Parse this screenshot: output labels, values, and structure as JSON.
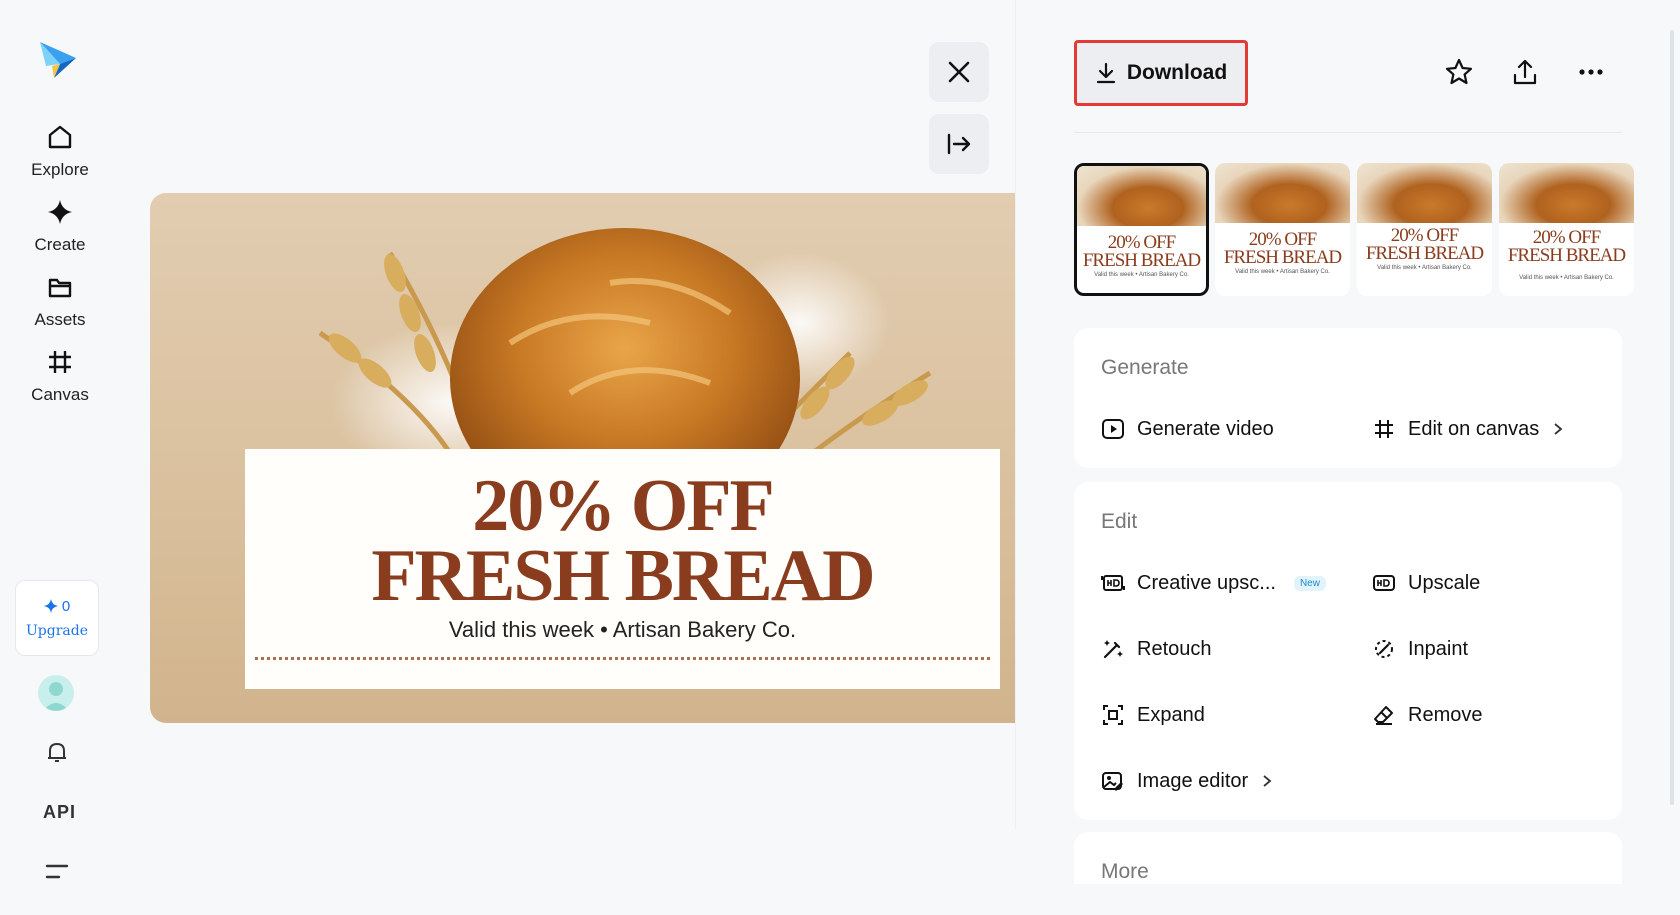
{
  "nav": {
    "items": [
      {
        "label": "Explore",
        "icon": "home-icon"
      },
      {
        "label": "Create",
        "icon": "sparkle-icon"
      },
      {
        "label": "Assets",
        "icon": "folder-icon"
      },
      {
        "label": "Canvas",
        "icon": "crop-icon"
      }
    ],
    "upgrade": {
      "credits": "0",
      "label": "Upgrade"
    },
    "api_label": "API"
  },
  "preview": {
    "headline_1": "20% OFF",
    "headline_2": "FRESH BREAD",
    "subtext": "Valid this week • Artisan Bakery Co."
  },
  "toolbar": {
    "download_label": "Download",
    "icons": [
      "star-icon",
      "share-icon",
      "more-icon"
    ]
  },
  "thumbnails": [
    {
      "line1": "20% OFF",
      "line2": "FRESH BREAD",
      "sub": "Valid this week • Artisan Bakery Co.",
      "selected": true
    },
    {
      "line1": "20% OFF",
      "line2": "FRESH BREAD",
      "sub": "Valid this week • Artisan Bakery Co.",
      "selected": false
    },
    {
      "line1": "20% OFF",
      "line2": "FRESH BREAD",
      "sub": "Valid this week • Artisan Bakery Co.",
      "selected": false
    },
    {
      "line1": "20% OFF",
      "line2": "FRESH BREAD",
      "sub": "Valid this week • Artisan Bakery Co.",
      "selected": false
    }
  ],
  "generate": {
    "title": "Generate",
    "actions": [
      {
        "label": "Generate video",
        "icon": "play-icon"
      },
      {
        "label": "Edit on canvas",
        "icon": "crop-icon"
      }
    ]
  },
  "edit": {
    "title": "Edit",
    "actions": [
      {
        "label": "Creative upsc...",
        "icon": "hd-plus-icon",
        "badge": "New"
      },
      {
        "label": "Upscale",
        "icon": "hd-icon"
      },
      {
        "label": "Retouch",
        "icon": "magic-wand-icon"
      },
      {
        "label": "Inpaint",
        "icon": "inpaint-icon"
      },
      {
        "label": "Expand",
        "icon": "expand-icon"
      },
      {
        "label": "Remove",
        "icon": "eraser-icon"
      },
      {
        "label": "Image editor",
        "icon": "image-edit-icon"
      }
    ]
  },
  "more": {
    "title": "More"
  },
  "colors": {
    "accent": "#1a73e8",
    "highlight": "#e53935",
    "headline": "#8a3d1e"
  }
}
